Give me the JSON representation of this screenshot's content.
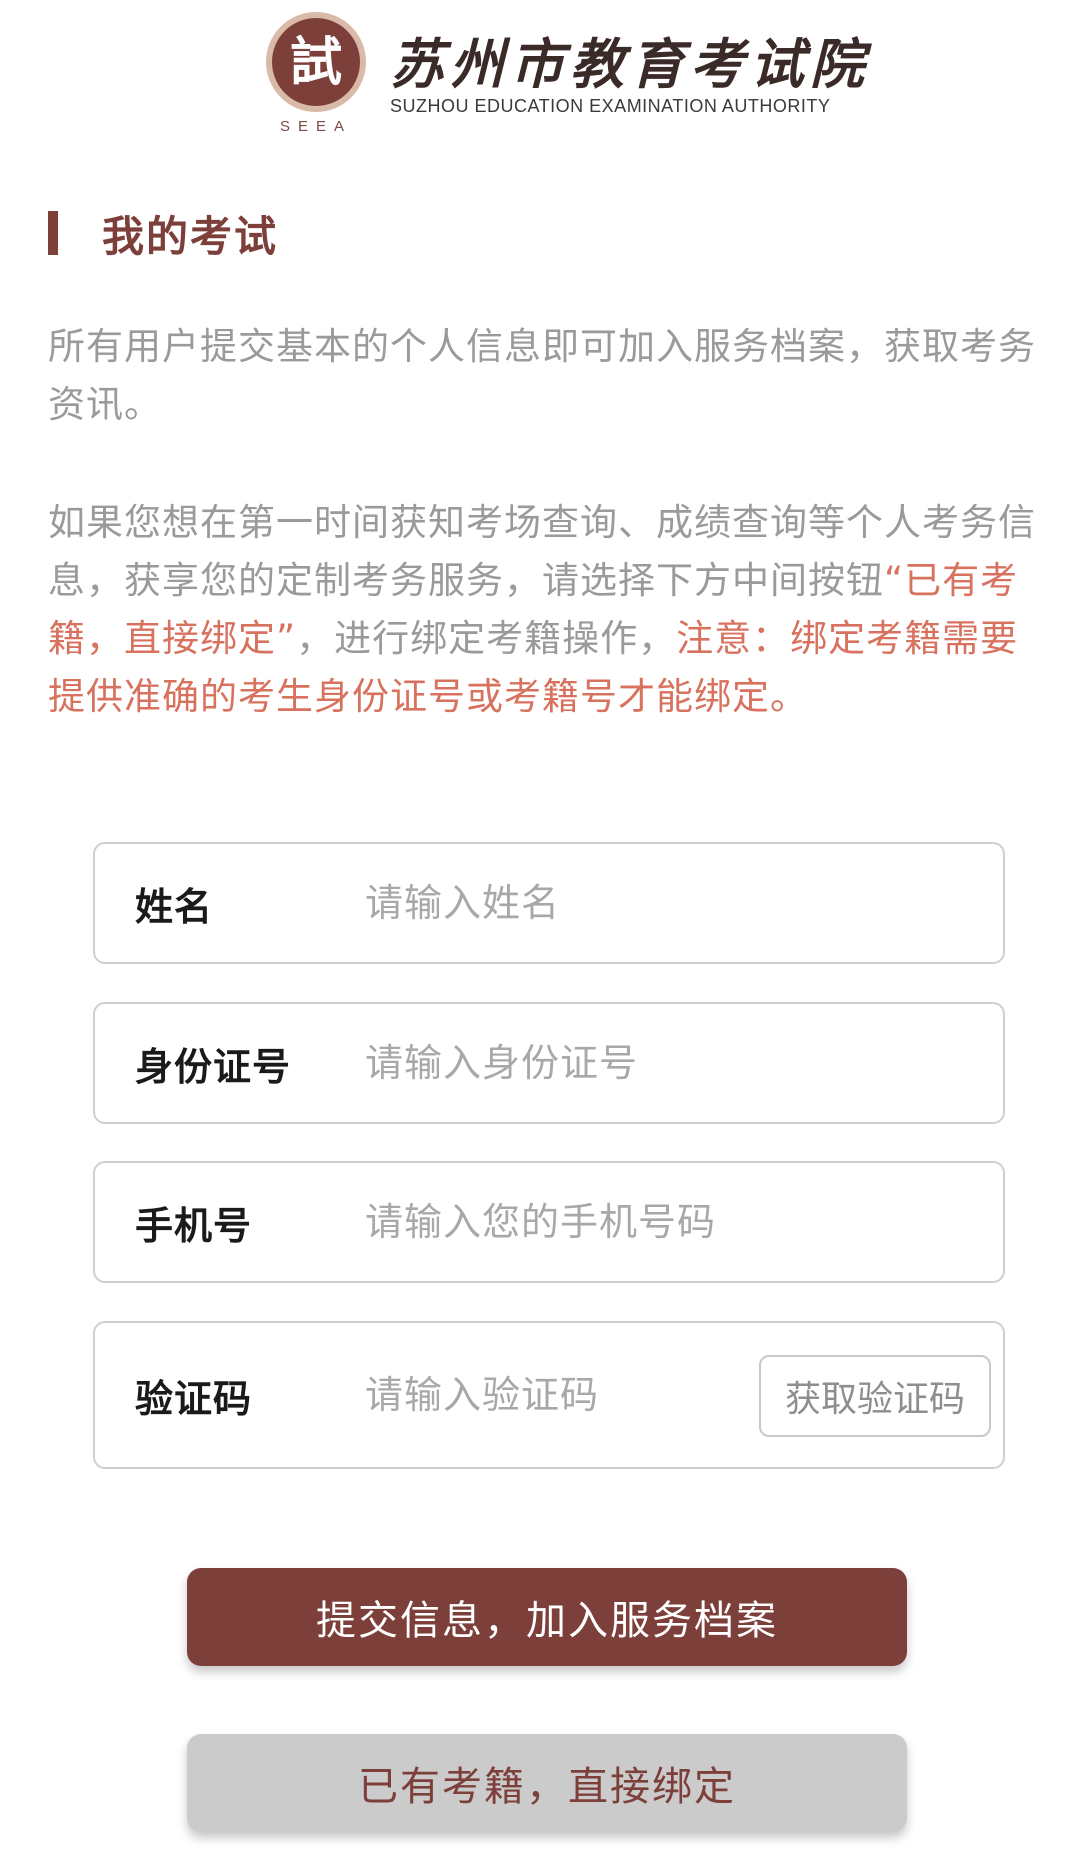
{
  "header": {
    "seal_char": "試",
    "seal_caption": "SEEA",
    "org_name_cn": "苏州市教育考试院",
    "org_name_en": "SUZHOU EDUCATION EXAMINATION AUTHORITY"
  },
  "section": {
    "title": "我的考试"
  },
  "intro": {
    "paragraph1": "所有用户提交基本的个人信息即可加入服务档案，获取考务资讯。",
    "paragraph2_prefix": "如果您想在第一时间获知考场查询、成绩查询等个人考务信息，获享您的定制考务服务，请选择下方中间按钮",
    "paragraph2_quote": "“已有考籍，直接绑定”",
    "paragraph2_middle": "，进行绑定考籍操作，",
    "paragraph2_notice": "注意：绑定考籍需要提供准确的考生身份证号或考籍号才能绑定。"
  },
  "form": {
    "name": {
      "label": "姓名",
      "placeholder": "请输入姓名",
      "value": ""
    },
    "id_number": {
      "label": "身份证号",
      "placeholder": "请输入身份证号",
      "value": ""
    },
    "phone": {
      "label": "手机号",
      "placeholder": "请输入您的手机号码",
      "value": ""
    },
    "code": {
      "label": "验证码",
      "placeholder": "请输入验证码",
      "value": "",
      "button_label": "获取验证码"
    }
  },
  "actions": {
    "submit_label": "提交信息，加入服务档案",
    "bind_label": "已有考籍，直接绑定"
  },
  "colors": {
    "brand": "#7d3f3a",
    "notice": "#d8725f",
    "body_text": "#9a9a9a",
    "secondary_button": "#cbcbcb"
  }
}
